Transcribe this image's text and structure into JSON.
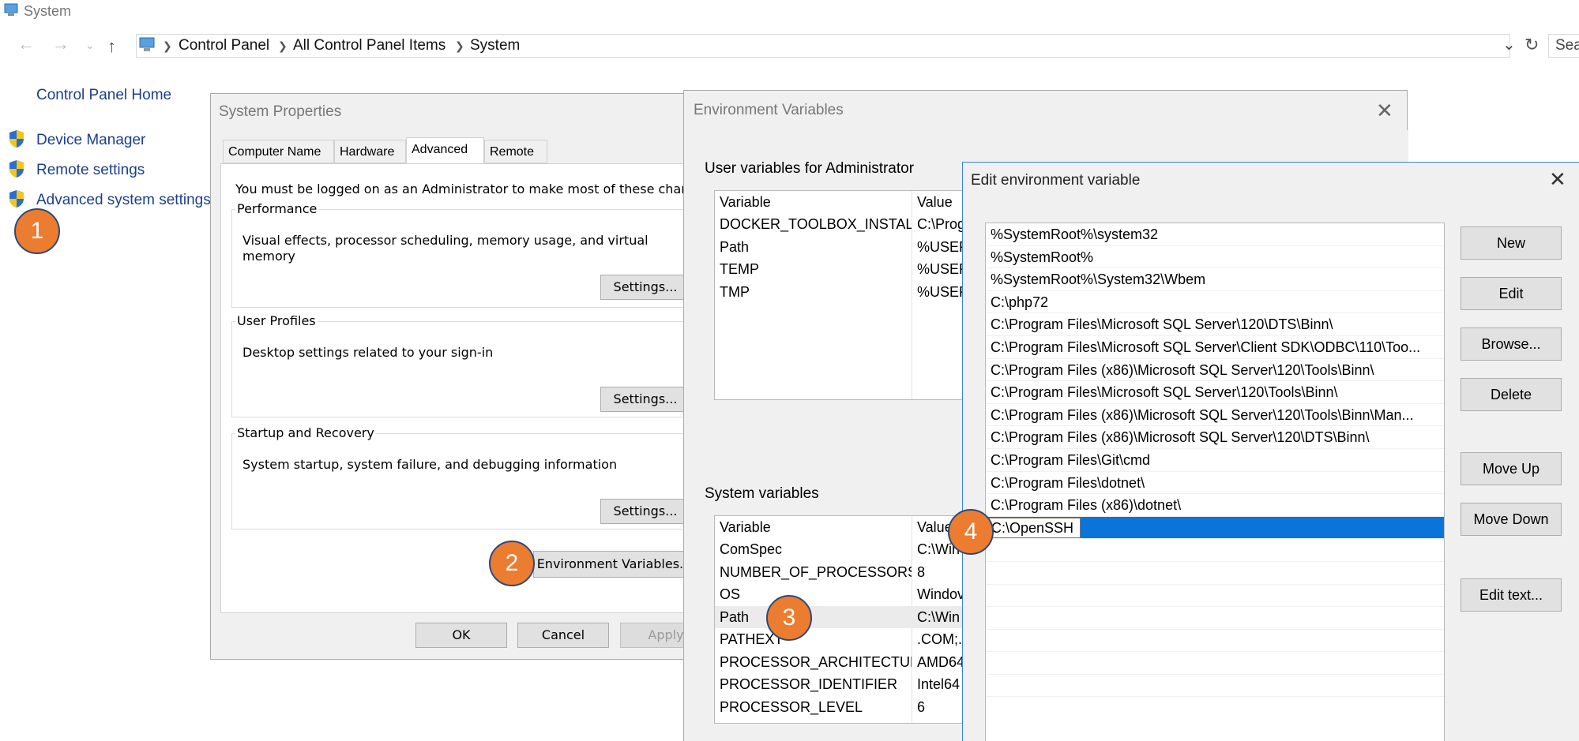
{
  "window": {
    "title": "System"
  },
  "address": {
    "crumbs": [
      "Control Panel",
      "All Control Panel Items",
      "System"
    ],
    "search_placeholder": "Sea"
  },
  "left_nav": {
    "home": "Control Panel Home",
    "items": [
      "Device Manager",
      "Remote settings",
      "Advanced system settings"
    ]
  },
  "steps": [
    "1",
    "2",
    "3",
    "4"
  ],
  "system_properties": {
    "title": "System Properties",
    "tabs": [
      "Computer Name",
      "Hardware",
      "Advanced",
      "Remote"
    ],
    "active_tab": "Advanced",
    "admin_note": "You must be logged on as an Administrator to make most of these change",
    "performance": {
      "label": "Performance",
      "text": "Visual effects, processor scheduling, memory usage, and virtual memory",
      "button": "Settings..."
    },
    "profiles": {
      "label": "User Profiles",
      "text": "Desktop settings related to your sign-in",
      "button": "Settings..."
    },
    "startup": {
      "label": "Startup and Recovery",
      "text": "System startup, system failure, and debugging information",
      "button": "Settings..."
    },
    "env_button": "Environment Variables...",
    "ok": "OK",
    "cancel": "Cancel",
    "apply": "Apply"
  },
  "env_vars": {
    "title": "Environment Variables",
    "user_label": "User variables for Administrator",
    "user_headers": [
      "Variable",
      "Value"
    ],
    "user_rows": [
      [
        "DOCKER_TOOLBOX_INSTAL...",
        "C:\\Prog"
      ],
      [
        "Path",
        "%USER"
      ],
      [
        "TEMP",
        "%USER"
      ],
      [
        "TMP",
        "%USER"
      ]
    ],
    "system_label": "System variables",
    "system_headers": [
      "Variable",
      "Value"
    ],
    "system_rows": [
      [
        "ComSpec",
        "C:\\Win"
      ],
      [
        "NUMBER_OF_PROCESSORS",
        "8"
      ],
      [
        "OS",
        "Windov"
      ],
      [
        "Path",
        "C:\\Win"
      ],
      [
        "PATHEXT",
        ".COM;.I"
      ],
      [
        "PROCESSOR_ARCHITECTURE",
        "AMD64"
      ],
      [
        "PROCESSOR_IDENTIFIER",
        "Intel64"
      ],
      [
        "PROCESSOR_LEVEL",
        "6"
      ]
    ]
  },
  "edit_env": {
    "title": "Edit environment variable",
    "paths": [
      "%SystemRoot%\\system32",
      "%SystemRoot%",
      "%SystemRoot%\\System32\\Wbem",
      "C:\\php72",
      "C:\\Program Files\\Microsoft SQL Server\\120\\DTS\\Binn\\",
      "C:\\Program Files\\Microsoft SQL Server\\Client SDK\\ODBC\\110\\Too...",
      "C:\\Program Files (x86)\\Microsoft SQL Server\\120\\Tools\\Binn\\",
      "C:\\Program Files\\Microsoft SQL Server\\120\\Tools\\Binn\\",
      "C:\\Program Files (x86)\\Microsoft SQL Server\\120\\Tools\\Binn\\Man...",
      "C:\\Program Files (x86)\\Microsoft SQL Server\\120\\DTS\\Binn\\",
      "C:\\Program Files\\Git\\cmd",
      "C:\\Program Files\\dotnet\\",
      "C:\\Program Files (x86)\\dotnet\\"
    ],
    "editing_value": "C:\\OpenSSH",
    "buttons": {
      "new": "New",
      "edit": "Edit",
      "browse": "Browse...",
      "delete": "Delete",
      "move_up": "Move Up",
      "move_down": "Move Down",
      "edit_text": "Edit text..."
    }
  },
  "colors": {
    "accent_blue": "#0a74da",
    "badge_orange": "#ec7c30",
    "link_blue": "#1c3f8b"
  }
}
